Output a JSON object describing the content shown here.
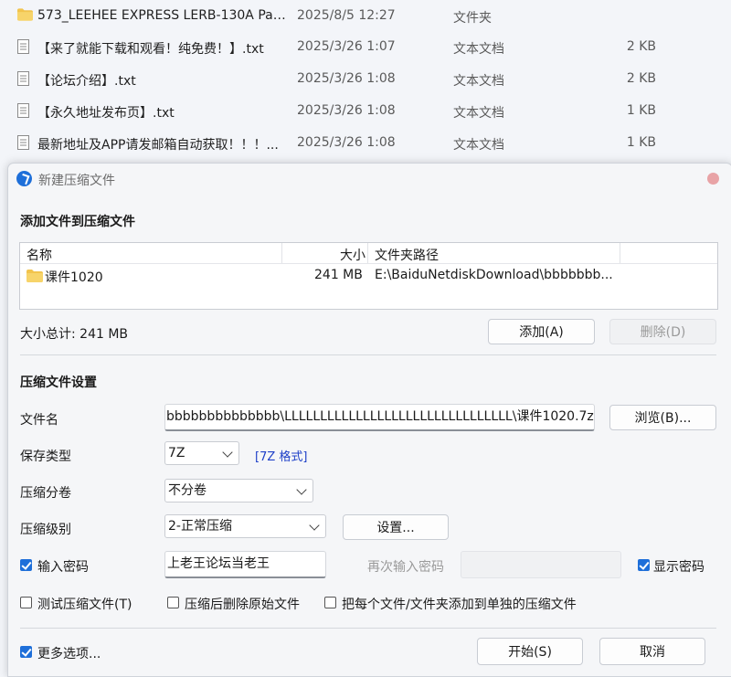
{
  "explorer": {
    "rows": [
      {
        "name": "573_LEEHEE EXPRESS LERB-130A Par...",
        "date": "2025/8/5 12:27",
        "type": "文件夹",
        "size": "",
        "icon": "folder-icon"
      },
      {
        "name": "【来了就能下载和观看！纯免费！】.txt",
        "date": "2025/3/26 1:07",
        "type": "文本文档",
        "size": "2 KB",
        "icon": "text-file-icon"
      },
      {
        "name": "【论坛介绍】.txt",
        "date": "2025/3/26 1:08",
        "type": "文本文档",
        "size": "2 KB",
        "icon": "text-file-icon"
      },
      {
        "name": "【永久地址发布页】.txt",
        "date": "2025/3/26 1:08",
        "type": "文本文档",
        "size": "1 KB",
        "icon": "text-file-icon"
      },
      {
        "name": "最新地址及APP请发邮箱自动获取！！！...",
        "date": "2025/3/26 1:08",
        "type": "文本文档",
        "size": "1 KB",
        "icon": "text-file-icon"
      }
    ]
  },
  "dialog": {
    "title": "新建压缩文件",
    "add_section": "添加文件到压缩文件",
    "list": {
      "headers": {
        "name": "名称",
        "size": "大小",
        "path": "文件夹路径"
      },
      "rows": [
        {
          "name": "课件1020",
          "size": "241 MB",
          "path": "E:\\BaiduNetdiskDownload\\bbbbbbb..."
        }
      ]
    },
    "total": "大小总计: 241 MB",
    "add_button": "添加(A)",
    "delete_button": "删除(D)",
    "settings_section": "压缩文件设置",
    "filename_label": "文件名",
    "filename_value": "bbbbbbbbbbbbbb\\LLLLLLLLLLLLLLLLLLLLLLLLLLLLLLLL\\课件1020.7z",
    "browse_button": "浏览(B)...",
    "save_type_label": "保存类型",
    "save_type_value": "7Z",
    "format_link": "[7Z 格式]",
    "split_label": "压缩分卷",
    "split_value": "不分卷",
    "level_label": "压缩级别",
    "level_value": "2-正常压缩",
    "settings_button": "设置...",
    "password_label": "输入密码",
    "password_value": "上老王论坛当老王",
    "reenter_label": "再次输入密码",
    "show_password_label": "显示密码",
    "test_label": "测试压缩文件(T)",
    "delete_after_label": "压缩后删除原始文件",
    "each_separate_label": "把每个文件/文件夹添加到单独的压缩文件",
    "more_options_label": "更多选项...",
    "start_button": "开始(S)",
    "cancel_button": "取消",
    "checks": {
      "password": true,
      "show_password": true,
      "test": false,
      "delete_after": false,
      "each_separate": false,
      "more_options": true
    }
  }
}
